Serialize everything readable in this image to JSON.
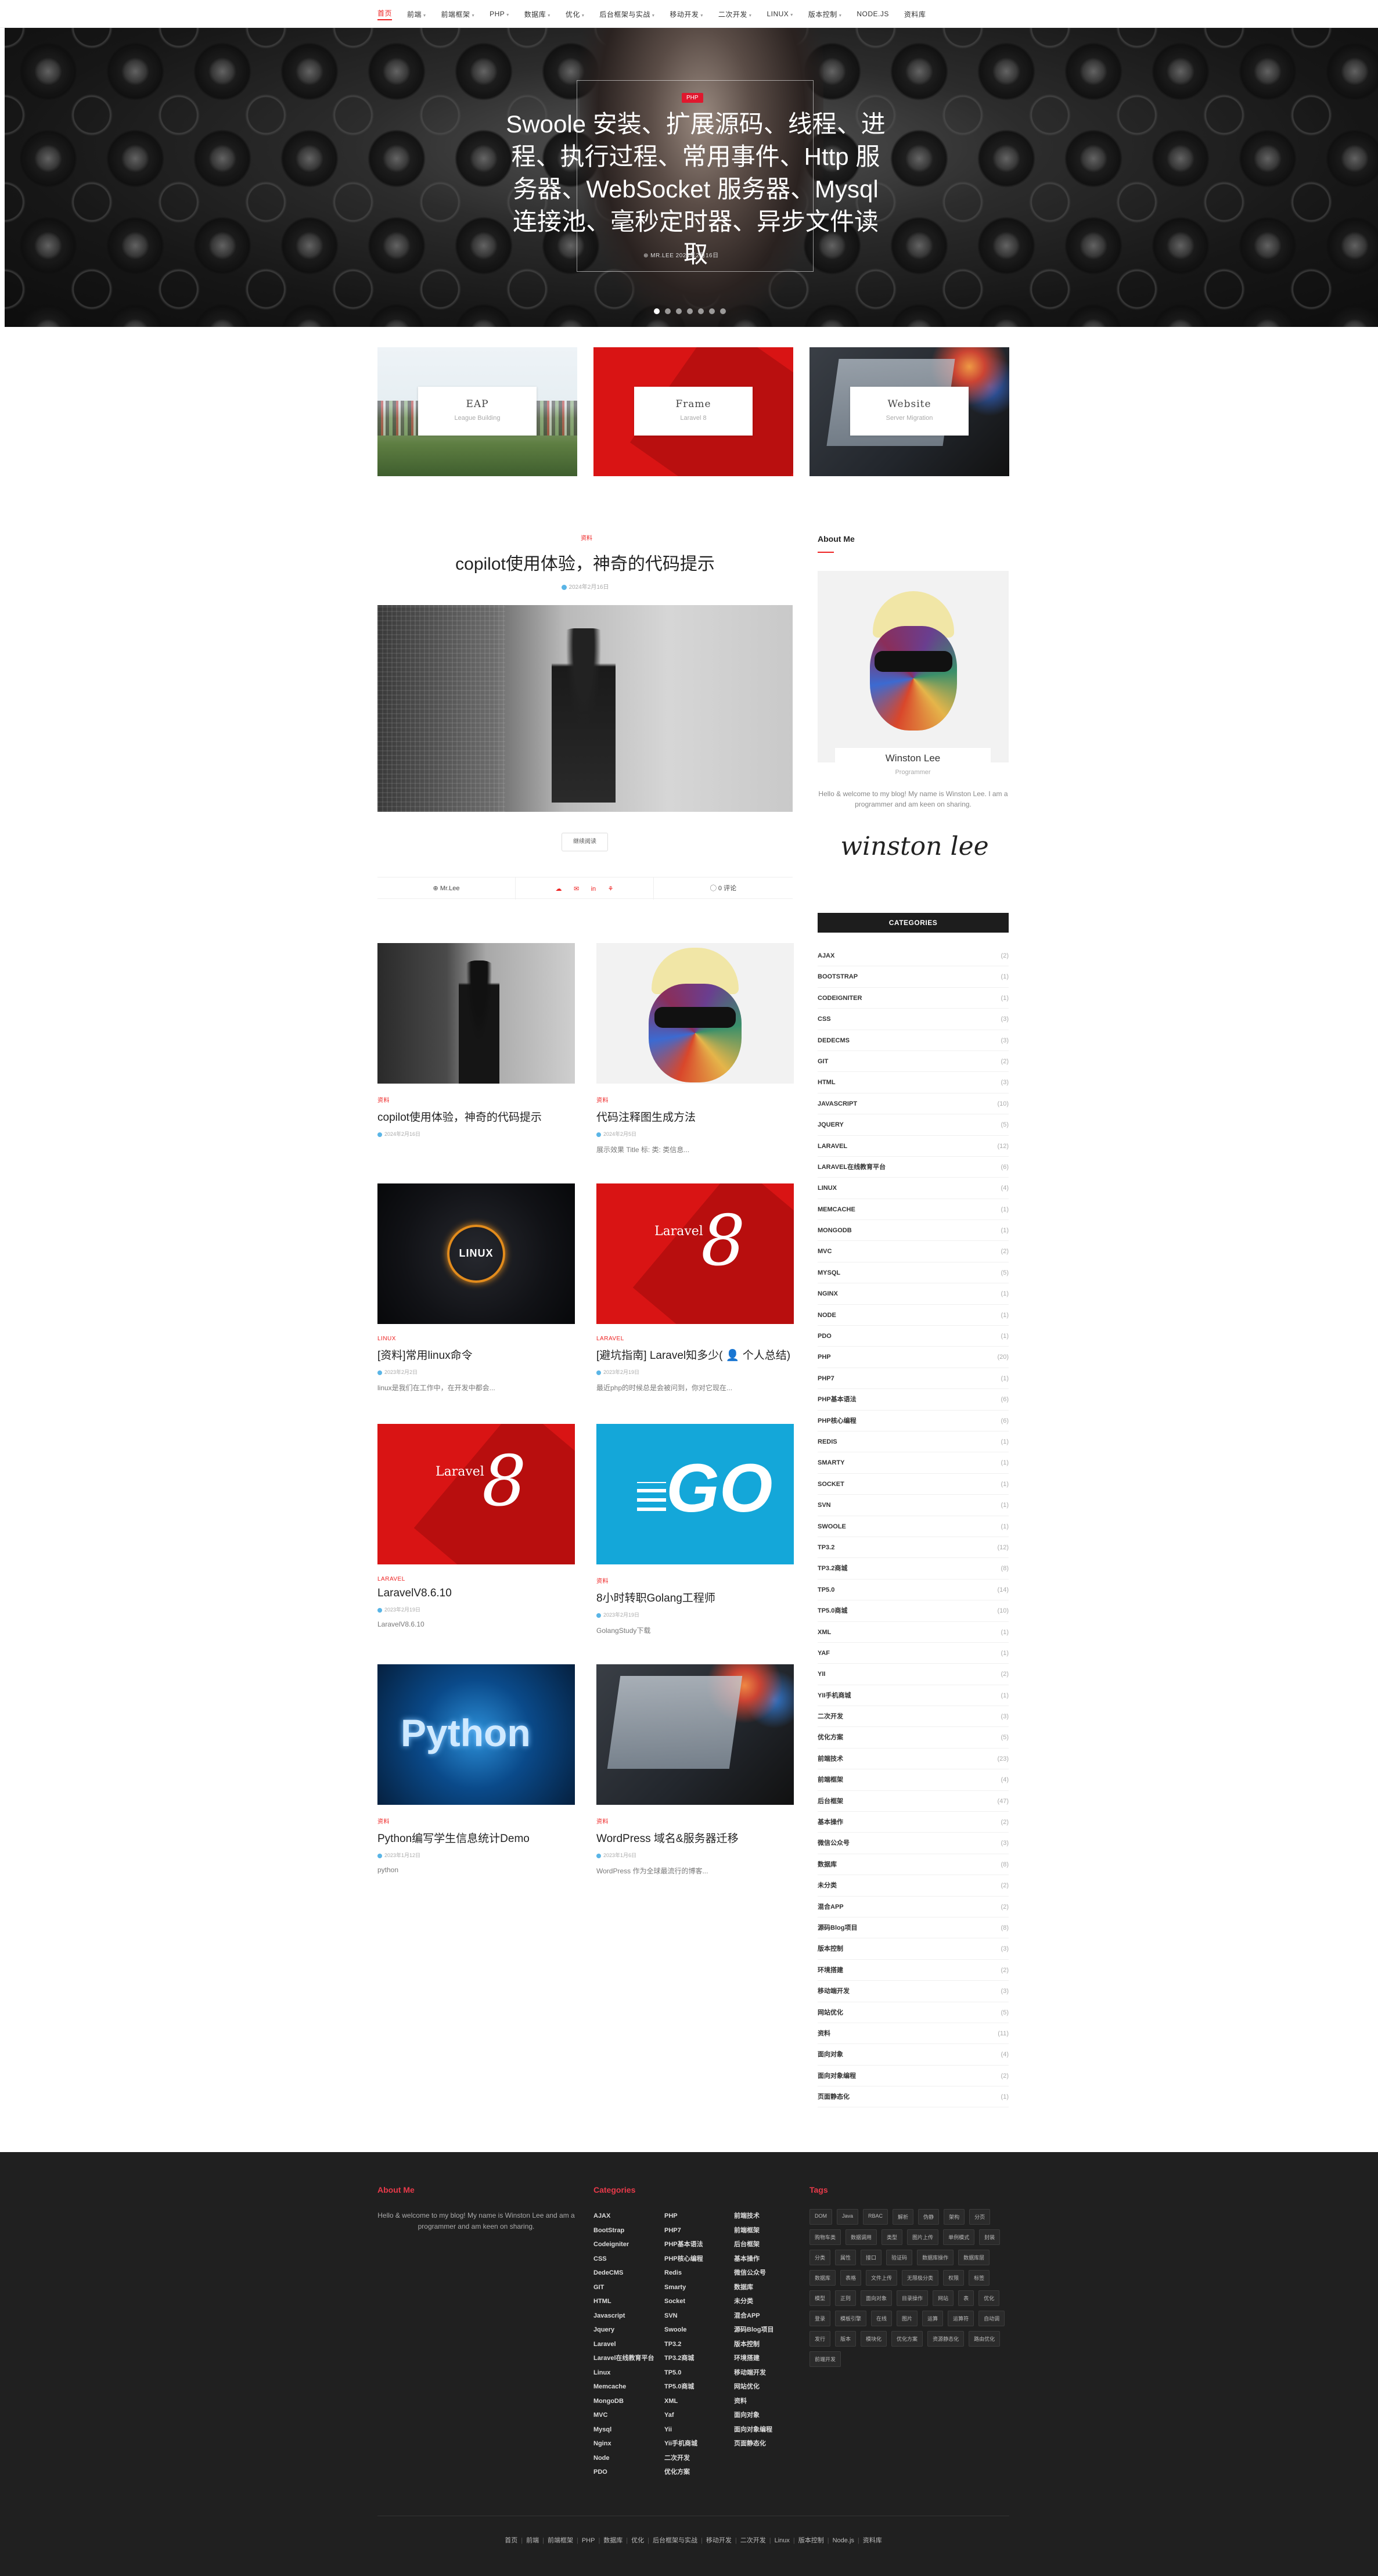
{
  "nav": {
    "items": [
      {
        "label": "首页",
        "caret": ""
      },
      {
        "label": "前端",
        "caret": "▾"
      },
      {
        "label": "前端框架",
        "caret": "▾"
      },
      {
        "label": "PHP",
        "caret": "▾"
      },
      {
        "label": "数据库",
        "caret": "▾"
      },
      {
        "label": "优化",
        "caret": "▾"
      },
      {
        "label": "后台框架与实战",
        "caret": "▾"
      },
      {
        "label": "移动开发",
        "caret": "▾"
      },
      {
        "label": "二次开发",
        "caret": "▾"
      },
      {
        "label": "LINUX",
        "caret": "▾"
      },
      {
        "label": "版本控制",
        "caret": "▾"
      },
      {
        "label": "NODE.JS",
        "caret": ""
      },
      {
        "label": "资料库",
        "caret": ""
      }
    ]
  },
  "hero": {
    "category": "PHP",
    "title": "Swoole 安装、扩展源码、线程、进程、执行过程、常用事件、Http 服务器、WebSocket 服务器、Mysql 连接池、毫秒定时器、异步文件读取",
    "meta": "⊕ MR.LEE  2024年2月16日"
  },
  "features": [
    {
      "title": "EAP",
      "subtitle": "League Building"
    },
    {
      "title": "Frame",
      "subtitle": "Laravel 8"
    },
    {
      "title": "Website",
      "subtitle": "Server Migration"
    }
  ],
  "featured_post": {
    "category": "资料",
    "title": "copilot使用体验，神奇的代码提示",
    "date": "2024年2月16日",
    "read_more": "继续阅读",
    "author": "⊕ Mr.Lee",
    "share_icons": [
      "☁",
      "✉",
      "in",
      "⚘"
    ],
    "comments": "◯ 0 评论"
  },
  "grid_posts": [
    {
      "category": "资料",
      "title": "copilot使用体验，神奇的代码提示",
      "date": "2024年2月16日",
      "excerpt": ""
    },
    {
      "category": "资料",
      "title": "代码注释图生成方法",
      "date": "2024年2月5日",
      "excerpt": "展示效果 Title 标: 类: 类信息..."
    },
    {
      "category": "LINUX",
      "title": "[资料]常用linux命令",
      "date": "2023年2月2日",
      "excerpt": "linux是我们在工作中，在开发中都会..."
    },
    {
      "category": "LARAVEL",
      "title": "[避坑指南] Laravel知多少( 👤 个人总结)",
      "date": "2023年2月19日",
      "excerpt": "最近php的时候总是会被问到，你对它现在..."
    },
    {
      "category": "LARAVEL",
      "title": "LaravelV8.6.10",
      "date": "2023年2月19日",
      "excerpt": "LaravelV8.6.10"
    },
    {
      "category": "资料",
      "title": "8小时转职Golang工程师",
      "date": "2023年2月19日",
      "excerpt": "GolangStudy下载"
    },
    {
      "category": "资料",
      "title": "Python编写学生信息统计Demo",
      "date": "2023年1月12日",
      "excerpt": "python"
    },
    {
      "category": "资料",
      "title": "WordPress 域名&服务器迁移",
      "date": "2023年1月6日",
      "excerpt": "WordPress 作为全球最流行的博客..."
    }
  ],
  "about": {
    "heading": "About Me",
    "name": "Winston Lee",
    "role": "Programmer",
    "desc": "Hello & welcome to my blog! My name is Winston Lee. I am a programmer and am keen on sharing.",
    "signature": "winston lee"
  },
  "categories": {
    "heading": "CATEGORIES",
    "items": [
      {
        "name": "AJAX",
        "count": "(2)"
      },
      {
        "name": "BOOTSTRAP",
        "count": "(1)"
      },
      {
        "name": "CODEIGNITER",
        "count": "(1)"
      },
      {
        "name": "CSS",
        "count": "(3)"
      },
      {
        "name": "DEDECMS",
        "count": "(3)"
      },
      {
        "name": "GIT",
        "count": "(2)"
      },
      {
        "name": "HTML",
        "count": "(3)"
      },
      {
        "name": "JAVASCRIPT",
        "count": "(10)"
      },
      {
        "name": "JQUERY",
        "count": "(5)"
      },
      {
        "name": "LARAVEL",
        "count": "(12)"
      },
      {
        "name": "LARAVEL在线教育平台",
        "count": "(6)"
      },
      {
        "name": "LINUX",
        "count": "(4)"
      },
      {
        "name": "MEMCACHE",
        "count": "(1)"
      },
      {
        "name": "MONGODB",
        "count": "(1)"
      },
      {
        "name": "MVC",
        "count": "(2)"
      },
      {
        "name": "MYSQL",
        "count": "(5)"
      },
      {
        "name": "NGINX",
        "count": "(1)"
      },
      {
        "name": "NODE",
        "count": "(1)"
      },
      {
        "name": "PDO",
        "count": "(1)"
      },
      {
        "name": "PHP",
        "count": "(20)"
      },
      {
        "name": "PHP7",
        "count": "(1)"
      },
      {
        "name": "PHP基本语法",
        "count": "(6)"
      },
      {
        "name": "PHP核心编程",
        "count": "(6)"
      },
      {
        "name": "REDIS",
        "count": "(1)"
      },
      {
        "name": "SMARTY",
        "count": "(1)"
      },
      {
        "name": "SOCKET",
        "count": "(1)"
      },
      {
        "name": "SVN",
        "count": "(1)"
      },
      {
        "name": "SWOOLE",
        "count": "(1)"
      },
      {
        "name": "TP3.2",
        "count": "(12)"
      },
      {
        "name": "TP3.2商城",
        "count": "(8)"
      },
      {
        "name": "TP5.0",
        "count": "(14)"
      },
      {
        "name": "TP5.0商城",
        "count": "(10)"
      },
      {
        "name": "XML",
        "count": "(1)"
      },
      {
        "name": "YAF",
        "count": "(1)"
      },
      {
        "name": "YII",
        "count": "(2)"
      },
      {
        "name": "YII手机商城",
        "count": "(1)"
      },
      {
        "name": "二次开发",
        "count": "(3)"
      },
      {
        "name": "优化方案",
        "count": "(5)"
      },
      {
        "name": "前端技术",
        "count": "(23)"
      },
      {
        "name": "前端框架",
        "count": "(4)"
      },
      {
        "name": "后台框架",
        "count": "(47)"
      },
      {
        "name": "基本操作",
        "count": "(2)"
      },
      {
        "name": "微信公众号",
        "count": "(3)"
      },
      {
        "name": "数据库",
        "count": "(8)"
      },
      {
        "name": "未分类",
        "count": "(2)"
      },
      {
        "name": "混合APP",
        "count": "(2)"
      },
      {
        "name": "源码Blog项目",
        "count": "(8)"
      },
      {
        "name": "版本控制",
        "count": "(3)"
      },
      {
        "name": "环境搭建",
        "count": "(2)"
      },
      {
        "name": "移动端开发",
        "count": "(3)"
      },
      {
        "name": "网站优化",
        "count": "(5)"
      },
      {
        "name": "资料",
        "count": "(11)"
      },
      {
        "name": "面向对象",
        "count": "(4)"
      },
      {
        "name": "面向对象编程",
        "count": "(2)"
      },
      {
        "name": "页面静态化",
        "count": "(1)"
      }
    ]
  },
  "footer": {
    "about_heading": "About Me",
    "about_text": "Hello & welcome to my blog! My name is Winston Lee and am a programmer and am keen on sharing.",
    "categories_heading": "Categories",
    "tags_heading": "Tags",
    "col1": [
      "AJAX",
      "BootStrap",
      "Codeigniter",
      "CSS",
      "DedeCMS",
      "GIT",
      "HTML",
      "Javascript",
      "Jquery",
      "Laravel",
      "Laravel在线教育平台",
      "Linux",
      "Memcache",
      "MongoDB",
      "MVC",
      "Mysql",
      "Nginx",
      "Node",
      "PDO"
    ],
    "col2": [
      "PHP",
      "PHP7",
      "PHP基本语法",
      "PHP核心编程",
      "Redis",
      "Smarty",
      "Socket",
      "SVN",
      "Swoole",
      "TP3.2",
      "TP3.2商城",
      "TP5.0",
      "TP5.0商城",
      "XML",
      "Yaf",
      "Yii",
      "Yii手机商城",
      "二次开发",
      "优化方案"
    ],
    "col3": [
      "前端技术",
      "前端框架",
      "后台框架",
      "基本操作",
      "微信公众号",
      "数据库",
      "未分类",
      "混合APP",
      "源码Blog项目",
      "版本控制",
      "环境搭建",
      "移动端开发",
      "网站优化",
      "资料",
      "面向对象",
      "面向对象编程",
      "页面静态化"
    ],
    "tags": [
      "DOM",
      "Java",
      "RBAC",
      "解析",
      "伪静",
      "架构",
      "分页",
      "购物车类",
      "数据调用",
      "类型",
      "图片上传",
      "单例模式",
      "封装",
      "分类",
      "属性",
      "接口",
      "验证码",
      "数据库操作",
      "数据库层",
      "数据库",
      "表格",
      "文件上传",
      "无限极分类",
      "权限",
      "标签",
      "模型",
      "正则",
      "面向对象",
      "目录操作",
      "网站",
      "表",
      "优化",
      "登录",
      "模板引擎",
      "在线",
      "图片",
      "运算",
      "运算符",
      "自动调",
      "发行",
      "版本",
      "模块化",
      "优化方案",
      "资源静态化",
      "路由优化",
      "前端开发"
    ],
    "bottom_nav": [
      "首页",
      "前端",
      "前端框架",
      "PHP",
      "数据库",
      "优化",
      "后台框架与实战",
      "移动开发",
      "二次开发",
      "Linux",
      "版本控制",
      "Node.js",
      "资料库"
    ]
  }
}
